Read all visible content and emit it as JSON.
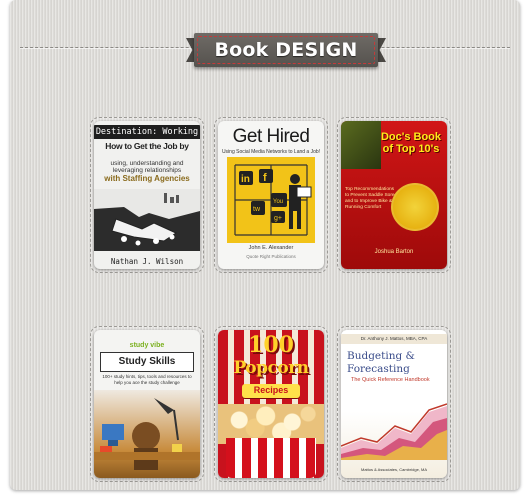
{
  "header": {
    "title": "Book DESIGN"
  },
  "books": [
    {
      "top_label": "Destination: Working",
      "title": "How to Get the Job by",
      "subtitle": "using, understanding and leveraging relationships",
      "tagline": "with Staffing Agencies",
      "author": "Nathan J. Wilson"
    },
    {
      "title": "Get Hired",
      "subtitle": "Using Social Media Networks to Land a Job!",
      "author": "John E. Alexander",
      "publisher": "Quote Right Publications"
    },
    {
      "title": "Doc's Book of Top 10's",
      "description": "Top Recommendations to Prevent Saddle Sores and to Improve Bike & Running Comfort",
      "author": "Joshua Barton"
    },
    {
      "brand_prefix": "stud",
      "brand_suffix": "y vibe",
      "title": "Study Skills",
      "subtitle": "100+ study hints, tips, tools and resources to help you ace the study challenge"
    },
    {
      "title_number": "100",
      "title_word": "Popcorn",
      "tag": "Recipes"
    },
    {
      "author": "Dr. Anthony J. Mattos, MBA, CPA",
      "title": "Budgeting & Forecasting",
      "subtitle": "The Quick Reference Handbook",
      "footer": "Mattos & Associates, Cambridge, MA"
    }
  ]
}
